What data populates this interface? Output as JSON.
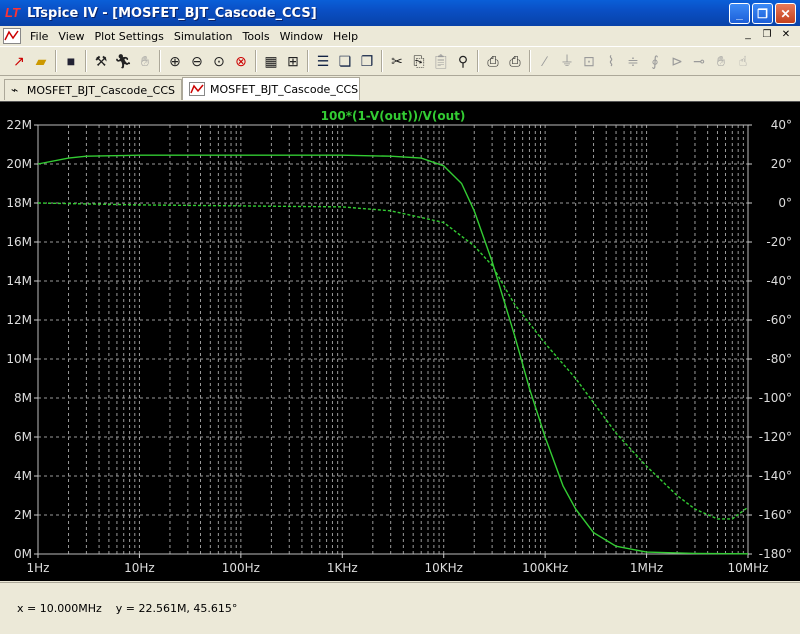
{
  "window": {
    "title": "LTspice IV - [MOSFET_BJT_Cascode_CCS]"
  },
  "title_buttons": [
    "minimize",
    "maximize",
    "close"
  ],
  "menu": [
    "File",
    "View",
    "Plot Settings",
    "Simulation",
    "Tools",
    "Window",
    "Help"
  ],
  "toolbar": {
    "icons": [
      "new-schematic-icon",
      "open-icon",
      "save-icon",
      "control-panel-icon",
      "run-icon",
      "halt-icon",
      "zoom-in-icon",
      "zoom-out-icon",
      "zoom-fit-icon",
      "zoom-cancel-icon",
      "autorange-icon",
      "pan-icon",
      "tile-horizontal-icon",
      "cascade-icon",
      "close-all-icon",
      "cut-icon",
      "copy-icon",
      "paste-icon",
      "find-icon",
      "print-icon",
      "print-preview-icon",
      "wire-icon",
      "ground-icon",
      "label-icon",
      "resistor-icon",
      "capacitor-icon",
      "inductor-icon",
      "diode-icon",
      "component-icon",
      "move-icon",
      "drag-icon"
    ]
  },
  "tabs": [
    {
      "label": "MOSFET_BJT_Cascode_CCS",
      "icon": "schematic-icon",
      "active": false
    },
    {
      "label": "MOSFET_BJT_Cascode_CCS",
      "icon": "waveform-icon",
      "active": true
    }
  ],
  "status": {
    "text": "x = 10.000MHz    y = 22.561M, 45.615°"
  },
  "colors": {
    "trace": "#33cc33",
    "plot_bg": "#000000",
    "grid": "#9a9a9a"
  },
  "chart_data": {
    "type": "line",
    "title": "100*(1-V(out))/V(out)",
    "x_scale": "log",
    "x_range": [
      1,
      10000000
    ],
    "x_ticks": [
      "1Hz",
      "10Hz",
      "100Hz",
      "1KHz",
      "10KHz",
      "100KHz",
      "1MHz",
      "10MHz"
    ],
    "y_left_range": [
      0,
      22000000
    ],
    "y_left_ticks": [
      "0M",
      "2M",
      "4M",
      "6M",
      "8M",
      "10M",
      "12M",
      "14M",
      "16M",
      "18M",
      "20M",
      "22M"
    ],
    "y_right_range": [
      -180,
      40
    ],
    "y_right_ticks": [
      "-180°",
      "-160°",
      "-140°",
      "-120°",
      "-100°",
      "-80°",
      "-60°",
      "-40°",
      "-20°",
      "0°",
      "20°",
      "40°"
    ],
    "grid": true,
    "series": [
      {
        "axis": "left",
        "style": "solid",
        "x": [
          1,
          2,
          3,
          10,
          100,
          1000,
          3000,
          6000,
          10000,
          15000,
          20000,
          30000,
          50000,
          70000,
          100000,
          150000,
          200000,
          300000,
          500000,
          1000000,
          3000000,
          10000000
        ],
        "y": [
          20000000,
          20300000,
          20400000,
          20450000,
          20450000,
          20450000,
          20400000,
          20300000,
          19900000,
          19000000,
          17600000,
          15000000,
          11200000,
          8500000,
          6000000,
          3500000,
          2300000,
          1100000,
          400000,
          100000,
          30000,
          10000
        ]
      },
      {
        "axis": "right",
        "style": "dashed",
        "x": [
          1,
          10,
          100,
          1000,
          3000,
          10000,
          20000,
          30000,
          50000,
          100000,
          200000,
          500000,
          1000000,
          2000000,
          3000000,
          5000000,
          7000000,
          10000000
        ],
        "y": [
          0,
          -1,
          -1.5,
          -2,
          -4,
          -10,
          -22,
          -32,
          -52,
          -72,
          -90,
          -118,
          -135,
          -150,
          -157,
          -162,
          -162,
          -156
        ]
      }
    ]
  }
}
